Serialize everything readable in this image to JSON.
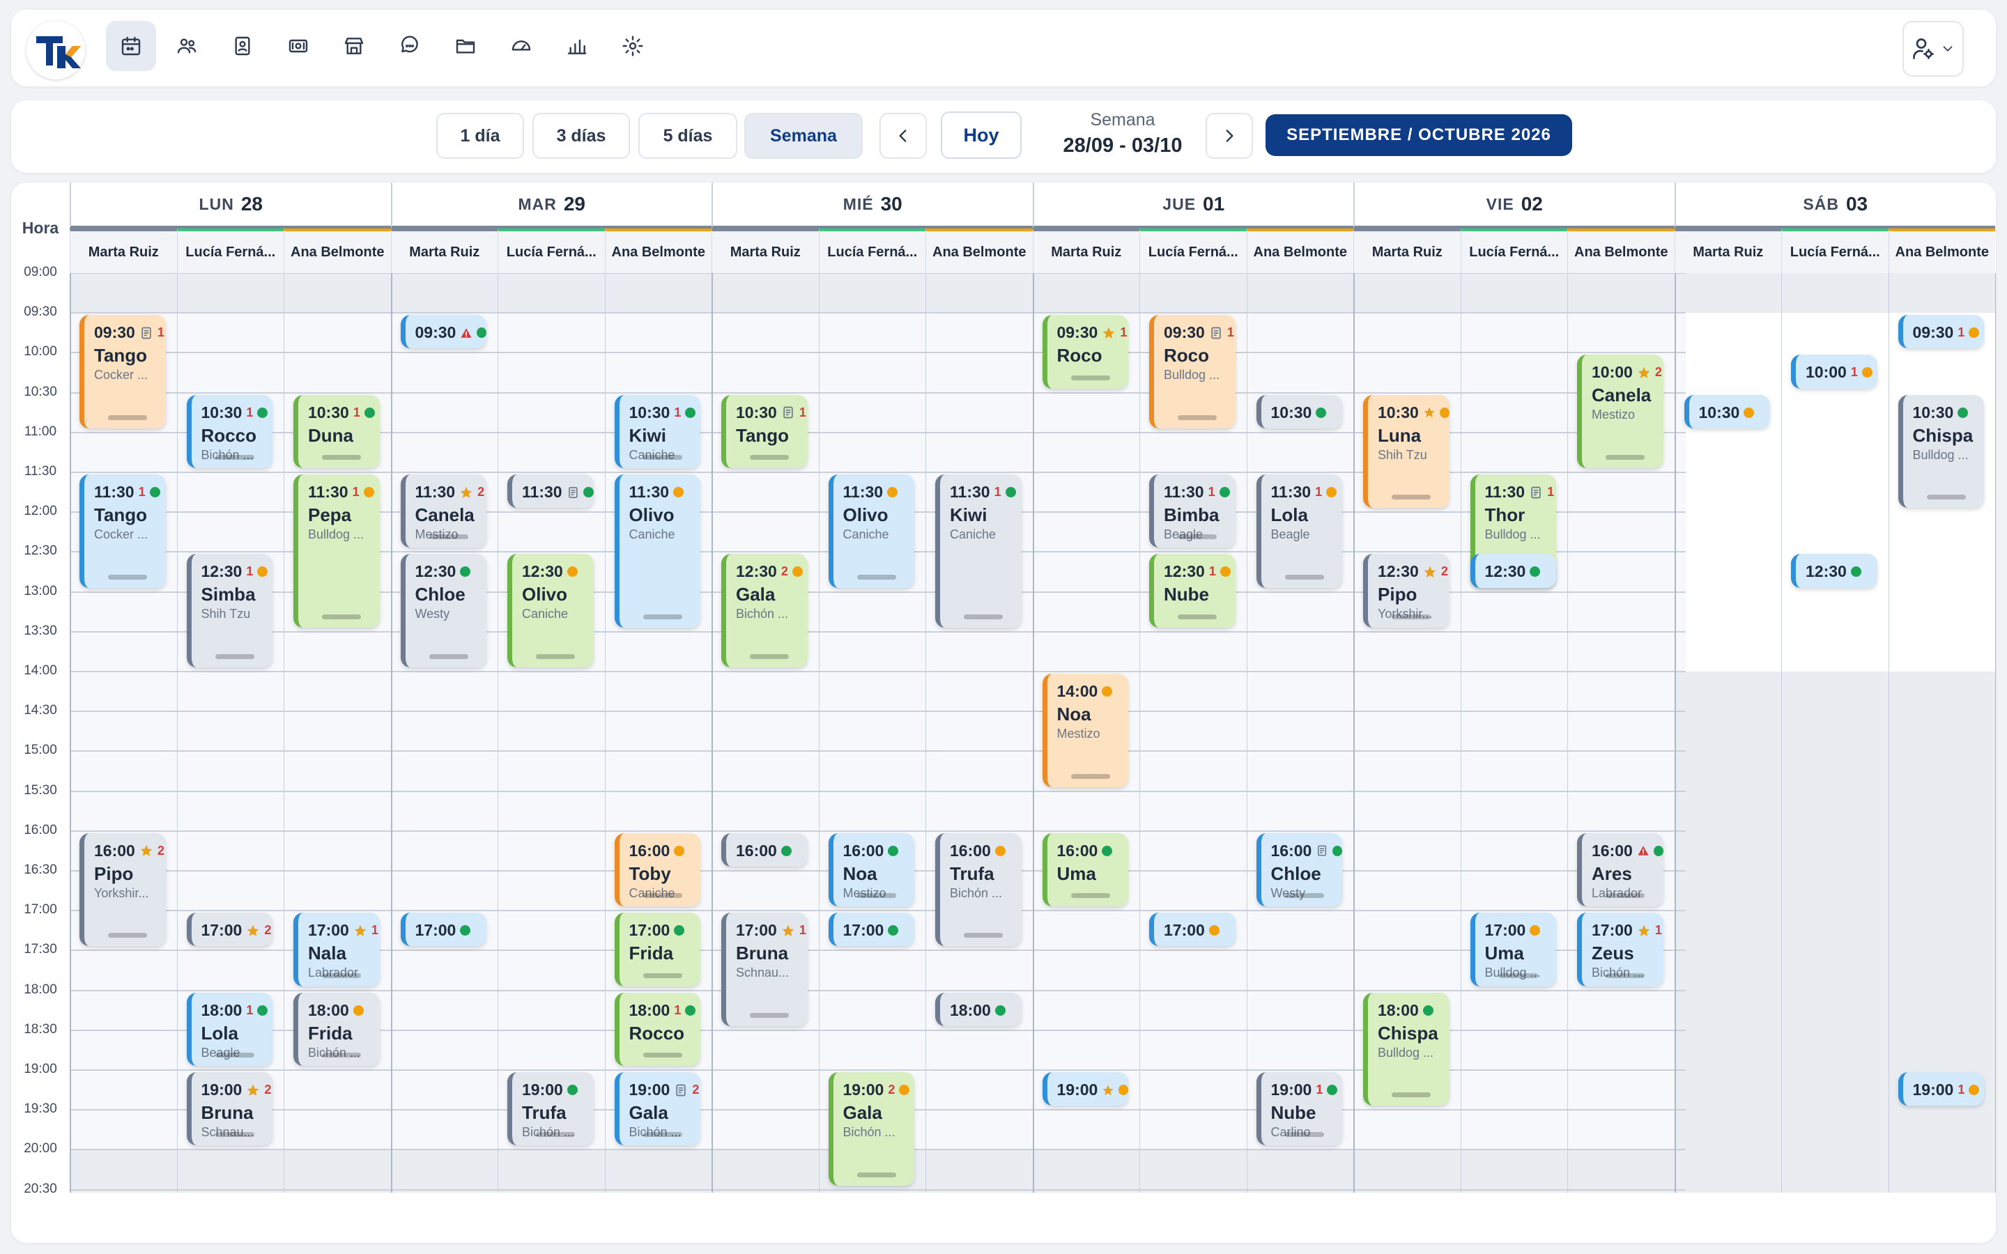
{
  "nav": {
    "icons": [
      "calendar-icon",
      "users-icon",
      "id-card-icon",
      "cash-icon",
      "store-icon",
      "chat-icon",
      "folder-icon",
      "dashboard-icon",
      "bar-chart-icon",
      "gear-icon"
    ],
    "active": 0
  },
  "toolbar": {
    "view_buttons": [
      "1 día",
      "3 días",
      "5 días",
      "Semana"
    ],
    "active_view": "Semana",
    "today_label": "Hoy",
    "week_label": "Semana",
    "week_range": "28/09 - 03/10",
    "month_label": "SEPTIEMBRE / OCTUBRE 2026"
  },
  "calendar": {
    "hour_header": "Hora",
    "hours": [
      "09:00",
      "09:30",
      "10:00",
      "10:30",
      "11:00",
      "11:30",
      "12:00",
      "12:30",
      "13:00",
      "13:30",
      "14:00",
      "14:30",
      "15:00",
      "15:30",
      "16:00",
      "16:30",
      "17:00",
      "17:30",
      "18:00",
      "18:30",
      "19:00",
      "19:30",
      "20:00",
      "20:30"
    ],
    "days": [
      {
        "name": "LUN",
        "date": "28"
      },
      {
        "name": "MAR",
        "date": "29"
      },
      {
        "name": "MIÉ",
        "date": "30"
      },
      {
        "name": "JUE",
        "date": "01"
      },
      {
        "name": "VIE",
        "date": "02"
      },
      {
        "name": "SÁB",
        "date": "03"
      }
    ],
    "staff": [
      {
        "name": "Marta Ruiz",
        "color": "#7a8799"
      },
      {
        "name": "Lucía Ferná...",
        "color": "#3cc47a"
      },
      {
        "name": "Ana Belmonte",
        "color": "#f1a10b"
      }
    ],
    "appointments": [
      {
        "day": 0,
        "col": 0,
        "time": "09:30",
        "name": "Tango",
        "breed": "Cocker ...",
        "start": "09:30",
        "end": "11:00",
        "color": "orange",
        "icons": [
          "note",
          "1"
        ],
        "status": ""
      },
      {
        "day": 0,
        "col": 0,
        "time": "11:30",
        "name": "Tango",
        "breed": "Cocker ...",
        "start": "11:30",
        "end": "13:00",
        "color": "blue",
        "icons": [
          "1"
        ],
        "status": "g"
      },
      {
        "day": 0,
        "col": 0,
        "time": "16:00",
        "name": "Pipo",
        "breed": "Yorkshir...",
        "start": "16:00",
        "end": "17:30",
        "color": "gray",
        "icons": [
          "star",
          "2"
        ],
        "status": ""
      },
      {
        "day": 0,
        "col": 1,
        "time": "10:30",
        "name": "Rocco",
        "breed": "Bichón ...",
        "start": "10:30",
        "end": "11:30",
        "color": "blue",
        "icons": [
          "1"
        ],
        "status": "g"
      },
      {
        "day": 0,
        "col": 1,
        "time": "12:30",
        "name": "Simba",
        "breed": "Shih Tzu",
        "start": "12:30",
        "end": "14:00",
        "color": "gray",
        "icons": [
          "1"
        ],
        "status": "o"
      },
      {
        "day": 0,
        "col": 1,
        "time": "17:00",
        "name": "",
        "breed": "",
        "start": "17:00",
        "end": "17:30",
        "color": "gray",
        "icons": [
          "star",
          "2"
        ],
        "status": ""
      },
      {
        "day": 0,
        "col": 1,
        "time": "18:00",
        "name": "Lola",
        "breed": "Beagle",
        "start": "18:00",
        "end": "19:00",
        "color": "blue",
        "icons": [
          "1"
        ],
        "status": "g"
      },
      {
        "day": 0,
        "col": 1,
        "time": "19:00",
        "name": "Bruna",
        "breed": "Schnau...",
        "start": "19:00",
        "end": "20:00",
        "color": "gray",
        "icons": [
          "star",
          "2"
        ],
        "status": ""
      },
      {
        "day": 0,
        "col": 2,
        "time": "10:30",
        "name": "Duna",
        "breed": "",
        "start": "10:30",
        "end": "11:30",
        "color": "green",
        "icons": [
          "1"
        ],
        "status": "g"
      },
      {
        "day": 0,
        "col": 2,
        "time": "11:30",
        "name": "Pepa",
        "breed": "Bulldog ...",
        "start": "11:30",
        "end": "13:30",
        "color": "green",
        "icons": [
          "1"
        ],
        "status": "o"
      },
      {
        "day": 0,
        "col": 2,
        "time": "17:00",
        "name": "Nala",
        "breed": "Labrador",
        "start": "17:00",
        "end": "18:00",
        "color": "blue",
        "icons": [
          "star",
          "1"
        ],
        "status": ""
      },
      {
        "day": 0,
        "col": 2,
        "time": "18:00",
        "name": "Frida",
        "breed": "Bichón ...",
        "start": "18:00",
        "end": "19:00",
        "color": "gray",
        "icons": [],
        "status": "o"
      },
      {
        "day": 1,
        "col": 0,
        "time": "09:30",
        "name": "",
        "breed": "",
        "start": "09:30",
        "end": "10:00",
        "color": "blue",
        "icons": [
          "warn"
        ],
        "status": "g"
      },
      {
        "day": 1,
        "col": 0,
        "time": "11:30",
        "name": "Canela",
        "breed": "Mestizo",
        "start": "11:30",
        "end": "12:30",
        "color": "gray",
        "icons": [
          "star",
          "2"
        ],
        "status": ""
      },
      {
        "day": 1,
        "col": 0,
        "time": "12:30",
        "name": "Chloe",
        "breed": "Westy",
        "start": "12:30",
        "end": "14:00",
        "color": "gray",
        "icons": [],
        "status": "g"
      },
      {
        "day": 1,
        "col": 0,
        "time": "17:00",
        "name": "",
        "breed": "",
        "start": "17:00",
        "end": "17:30",
        "color": "blue",
        "icons": [],
        "status": "g"
      },
      {
        "day": 1,
        "col": 1,
        "time": "11:30",
        "name": "",
        "breed": "",
        "start": "11:30",
        "end": "12:00",
        "color": "gray",
        "icons": [
          "note"
        ],
        "status": "g"
      },
      {
        "day": 1,
        "col": 1,
        "time": "12:30",
        "name": "Olivo",
        "breed": "Caniche",
        "start": "12:30",
        "end": "14:00",
        "color": "green",
        "icons": [],
        "status": "o"
      },
      {
        "day": 1,
        "col": 1,
        "time": "19:00",
        "name": "Trufa",
        "breed": "Bichón ...",
        "start": "19:00",
        "end": "20:00",
        "color": "gray",
        "icons": [],
        "status": "g"
      },
      {
        "day": 1,
        "col": 2,
        "time": "10:30",
        "name": "Kiwi",
        "breed": "Caniche",
        "start": "10:30",
        "end": "11:30",
        "color": "blue",
        "icons": [
          "1"
        ],
        "status": "g"
      },
      {
        "day": 1,
        "col": 2,
        "time": "11:30",
        "name": "Olivo",
        "breed": "Caniche",
        "start": "11:30",
        "end": "13:30",
        "color": "blue",
        "icons": [],
        "status": "o"
      },
      {
        "day": 1,
        "col": 2,
        "time": "16:00",
        "name": "Toby",
        "breed": "Caniche",
        "start": "16:00",
        "end": "17:00",
        "color": "orange",
        "icons": [],
        "status": "o"
      },
      {
        "day": 1,
        "col": 2,
        "time": "17:00",
        "name": "Frida",
        "breed": "",
        "start": "17:00",
        "end": "18:00",
        "color": "green",
        "icons": [],
        "status": "g"
      },
      {
        "day": 1,
        "col": 2,
        "time": "18:00",
        "name": "Rocco",
        "breed": "",
        "start": "18:00",
        "end": "19:00",
        "color": "green",
        "icons": [
          "1"
        ],
        "status": "g"
      },
      {
        "day": 1,
        "col": 2,
        "time": "19:00",
        "name": "Gala",
        "breed": "Bichón ...",
        "start": "19:00",
        "end": "20:00",
        "color": "blue",
        "icons": [
          "note",
          "2"
        ],
        "status": ""
      },
      {
        "day": 2,
        "col": 0,
        "time": "10:30",
        "name": "Tango",
        "breed": "",
        "start": "10:30",
        "end": "11:30",
        "color": "green",
        "icons": [
          "note",
          "1"
        ],
        "status": ""
      },
      {
        "day": 2,
        "col": 0,
        "time": "12:30",
        "name": "Gala",
        "breed": "Bichón ...",
        "start": "12:30",
        "end": "14:00",
        "color": "green",
        "icons": [
          "2"
        ],
        "status": "o"
      },
      {
        "day": 2,
        "col": 0,
        "time": "16:00",
        "name": "",
        "breed": "",
        "start": "16:00",
        "end": "16:30",
        "color": "gray",
        "icons": [],
        "status": "g"
      },
      {
        "day": 2,
        "col": 0,
        "time": "17:00",
        "name": "Bruna",
        "breed": "Schnau...",
        "start": "17:00",
        "end": "18:30",
        "color": "gray",
        "icons": [
          "star",
          "1"
        ],
        "status": ""
      },
      {
        "day": 2,
        "col": 1,
        "time": "11:30",
        "name": "Olivo",
        "breed": "Caniche",
        "start": "11:30",
        "end": "13:00",
        "color": "blue",
        "icons": [],
        "status": "o"
      },
      {
        "day": 2,
        "col": 1,
        "time": "16:00",
        "name": "Noa",
        "breed": "Mestizo",
        "start": "16:00",
        "end": "17:00",
        "color": "blue",
        "icons": [],
        "status": "g"
      },
      {
        "day": 2,
        "col": 1,
        "time": "17:00",
        "name": "",
        "breed": "",
        "start": "17:00",
        "end": "17:30",
        "color": "blue",
        "icons": [],
        "status": "g"
      },
      {
        "day": 2,
        "col": 1,
        "time": "19:00",
        "name": "Gala",
        "breed": "Bichón ...",
        "start": "19:00",
        "end": "20:30",
        "color": "green",
        "icons": [
          "2"
        ],
        "status": "o"
      },
      {
        "day": 2,
        "col": 2,
        "time": "11:30",
        "name": "Kiwi",
        "breed": "Caniche",
        "start": "11:30",
        "end": "13:30",
        "color": "gray",
        "icons": [
          "1"
        ],
        "status": "g"
      },
      {
        "day": 2,
        "col": 2,
        "time": "16:00",
        "name": "Trufa",
        "breed": "Bichón ...",
        "start": "16:00",
        "end": "17:30",
        "color": "gray",
        "icons": [],
        "status": "o"
      },
      {
        "day": 2,
        "col": 2,
        "time": "18:00",
        "name": "",
        "breed": "",
        "start": "18:00",
        "end": "18:30",
        "color": "gray",
        "icons": [],
        "status": "g"
      },
      {
        "day": 3,
        "col": 0,
        "time": "09:30",
        "name": "Roco",
        "breed": "",
        "start": "09:30",
        "end": "10:30",
        "color": "green",
        "icons": [
          "star",
          "1"
        ],
        "status": ""
      },
      {
        "day": 3,
        "col": 0,
        "time": "14:00",
        "name": "Noa",
        "breed": "Mestizo",
        "start": "14:00",
        "end": "15:30",
        "color": "orange",
        "icons": [],
        "status": "o"
      },
      {
        "day": 3,
        "col": 0,
        "time": "16:00",
        "name": "Uma",
        "breed": "",
        "start": "16:00",
        "end": "17:00",
        "color": "green",
        "icons": [],
        "status": "g"
      },
      {
        "day": 3,
        "col": 0,
        "time": "19:00",
        "name": "",
        "breed": "",
        "start": "19:00",
        "end": "19:30",
        "color": "blue",
        "icons": [
          "star"
        ],
        "status": "o"
      },
      {
        "day": 3,
        "col": 1,
        "time": "09:30",
        "name": "Roco",
        "breed": "Bulldog ...",
        "start": "09:30",
        "end": "11:00",
        "color": "orange",
        "icons": [
          "note",
          "1"
        ],
        "status": ""
      },
      {
        "day": 3,
        "col": 1,
        "time": "11:30",
        "name": "Bimba",
        "breed": "Beagle",
        "start": "11:30",
        "end": "12:30",
        "color": "gray",
        "icons": [
          "1"
        ],
        "status": "g"
      },
      {
        "day": 3,
        "col": 1,
        "time": "12:30",
        "name": "Nube",
        "breed": "",
        "start": "12:30",
        "end": "13:30",
        "color": "green",
        "icons": [
          "1"
        ],
        "status": "o"
      },
      {
        "day": 3,
        "col": 1,
        "time": "17:00",
        "name": "",
        "breed": "",
        "start": "17:00",
        "end": "17:30",
        "color": "blue",
        "icons": [],
        "status": "o"
      },
      {
        "day": 3,
        "col": 2,
        "time": "10:30",
        "name": "",
        "breed": "",
        "start": "10:30",
        "end": "11:00",
        "color": "gray",
        "icons": [],
        "status": "g"
      },
      {
        "day": 3,
        "col": 2,
        "time": "11:30",
        "name": "Lola",
        "breed": "Beagle",
        "start": "11:30",
        "end": "13:00",
        "color": "gray",
        "icons": [
          "1"
        ],
        "status": "o"
      },
      {
        "day": 3,
        "col": 2,
        "time": "16:00",
        "name": "Chloe",
        "breed": "Westy",
        "start": "16:00",
        "end": "17:00",
        "color": "blue",
        "icons": [
          "note"
        ],
        "status": "g"
      },
      {
        "day": 3,
        "col": 2,
        "time": "19:00",
        "name": "Nube",
        "breed": "Carlino",
        "start": "19:00",
        "end": "20:00",
        "color": "gray",
        "icons": [
          "1"
        ],
        "status": "g"
      },
      {
        "day": 4,
        "col": 0,
        "time": "10:30",
        "name": "Luna",
        "breed": "Shih Tzu",
        "start": "10:30",
        "end": "12:00",
        "color": "orange",
        "icons": [
          "star"
        ],
        "status": "o"
      },
      {
        "day": 4,
        "col": 0,
        "time": "12:30",
        "name": "Pipo",
        "breed": "Yorkshir...",
        "start": "12:30",
        "end": "13:30",
        "color": "gray",
        "icons": [
          "star",
          "2"
        ],
        "status": ""
      },
      {
        "day": 4,
        "col": 0,
        "time": "18:00",
        "name": "Chispa",
        "breed": "Bulldog ...",
        "start": "18:00",
        "end": "19:30",
        "color": "green",
        "icons": [],
        "status": "g"
      },
      {
        "day": 4,
        "col": 1,
        "time": "11:30",
        "name": "Thor",
        "breed": "Bulldog ...",
        "start": "11:30",
        "end": "13:00",
        "color": "green",
        "icons": [
          "note",
          "1"
        ],
        "status": ""
      },
      {
        "day": 4,
        "col": 1,
        "time": "12:30",
        "name": "",
        "breed": "",
        "start": "12:30",
        "end": "13:00",
        "color": "blue",
        "icons": [],
        "status": "g"
      },
      {
        "day": 4,
        "col": 1,
        "time": "17:00",
        "name": "Uma",
        "breed": "Bulldog ...",
        "start": "17:00",
        "end": "18:00",
        "color": "blue",
        "icons": [],
        "status": "o"
      },
      {
        "day": 4,
        "col": 2,
        "time": "10:00",
        "name": "Canela",
        "breed": "Mestizo",
        "start": "10:00",
        "end": "11:30",
        "color": "green",
        "icons": [
          "star",
          "2"
        ],
        "status": ""
      },
      {
        "day": 4,
        "col": 2,
        "time": "16:00",
        "name": "Ares",
        "breed": "Labrador",
        "start": "16:00",
        "end": "17:00",
        "color": "gray",
        "icons": [
          "warn"
        ],
        "status": "g"
      },
      {
        "day": 4,
        "col": 2,
        "time": "17:00",
        "name": "Zeus",
        "breed": "Bichón ...",
        "start": "17:00",
        "end": "18:00",
        "color": "blue",
        "icons": [
          "star",
          "1"
        ],
        "status": ""
      },
      {
        "day": 5,
        "col": 0,
        "time": "10:30",
        "name": "",
        "breed": "",
        "start": "10:30",
        "end": "11:00",
        "color": "blue",
        "icons": [],
        "status": "o"
      },
      {
        "day": 5,
        "col": 1,
        "time": "10:00",
        "name": "",
        "breed": "",
        "start": "10:00",
        "end": "10:30",
        "color": "blue",
        "icons": [
          "1"
        ],
        "status": "o"
      },
      {
        "day": 5,
        "col": 1,
        "time": "12:30",
        "name": "",
        "breed": "",
        "start": "12:30",
        "end": "13:00",
        "color": "blue",
        "icons": [],
        "status": "g"
      },
      {
        "day": 5,
        "col": 2,
        "time": "09:30",
        "name": "",
        "breed": "",
        "start": "09:30",
        "end": "10:00",
        "color": "blue",
        "icons": [
          "1"
        ],
        "status": "o"
      },
      {
        "day": 5,
        "col": 2,
        "time": "10:30",
        "name": "Chispa",
        "breed": "Bulldog ...",
        "start": "10:30",
        "end": "12:00",
        "color": "gray",
        "icons": [],
        "status": "g"
      },
      {
        "day": 5,
        "col": 2,
        "time": "19:00",
        "name": "",
        "breed": "",
        "start": "19:00",
        "end": "19:30",
        "color": "blue",
        "icons": [
          "1"
        ],
        "status": "o"
      }
    ]
  }
}
